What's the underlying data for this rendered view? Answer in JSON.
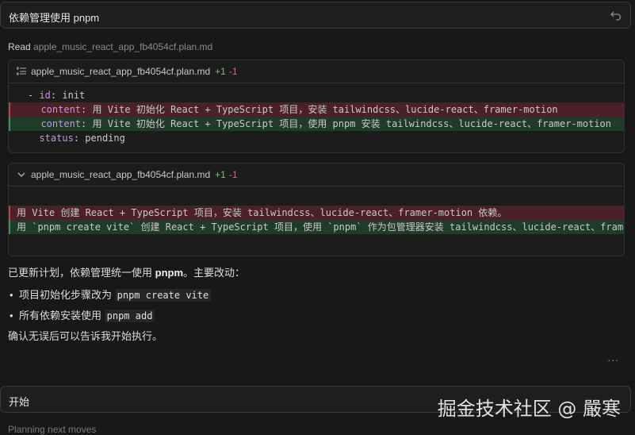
{
  "prompt": {
    "text": "依赖管理使用 pnpm"
  },
  "read": {
    "label": "Read",
    "file": "apple_music_react_app_fb4054cf.plan.md"
  },
  "diff1": {
    "file": "apple_music_react_app_fb4054cf.plan.md",
    "added": "+1",
    "removed": "-1",
    "lines": [
      {
        "type": "ctx",
        "indent": "",
        "prefix": "- ",
        "key": "id",
        "value": " init"
      },
      {
        "type": "del",
        "indent": "  ",
        "prefix": "",
        "key": "content",
        "value": " 用 Vite 初始化 React + TypeScript 项目，安装 tailwindcss、lucide-react、framer-motion"
      },
      {
        "type": "add",
        "indent": "  ",
        "prefix": "",
        "key": "content",
        "value": " 用 Vite 初始化 React + TypeScript 项目，使用 pnpm 安装 tailwindcss、lucide-react、framer-motion"
      },
      {
        "type": "ctx",
        "indent": "  ",
        "prefix": "",
        "key": "status",
        "value": " pending"
      }
    ]
  },
  "diff2": {
    "file": "apple_music_react_app_fb4054cf.plan.md",
    "added": "+1",
    "removed": "-1",
    "lines": [
      {
        "type": "del",
        "text": "用 Vite 创建 React + TypeScript 项目，安装 tailwindcss、lucide-react、framer-motion 依赖。"
      },
      {
        "type": "add",
        "text": "用 `pnpm create vite` 创建 React + TypeScript 项目，使用 `pnpm` 作为包管理器安装 tailwindcss、lucide-react、framer-motion"
      }
    ]
  },
  "summary": {
    "prefix": "已更新计划，依赖管理统一使用 ",
    "bold": "pnpm",
    "suffix": "。主要改动：",
    "bullets": [
      {
        "text": "项目初始化步骤改为 ",
        "code": "pnpm create vite"
      },
      {
        "text": "所有依赖安装使用 ",
        "code": "pnpm add"
      }
    ],
    "confirm": "确认无误后可以告诉我开始执行。"
  },
  "more": "...",
  "start": {
    "text": "开始"
  },
  "status": {
    "text": "Planning next moves"
  },
  "watermark": "掘金技术社区 @ 嚴寒",
  "icons": {
    "undo": "undo-icon",
    "list": "list-icon",
    "chevron": "chevron-down-icon"
  }
}
